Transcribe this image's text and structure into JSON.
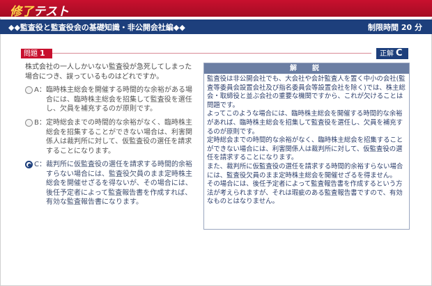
{
  "app": {
    "title_accent": "修了",
    "title_main": "テスト"
  },
  "subbar": {
    "subject": "◆◆監査役と監査役会の基礎知識・非公開会社編◆◆",
    "time_label": "制限時間 20 分"
  },
  "question": {
    "label": "問題",
    "number": "1",
    "text": "株式会社の一人しかいない監査役が急死してしまった場合につき、誤っているものはどれですか。"
  },
  "answer": {
    "label": "正解",
    "value": "C"
  },
  "options": [
    {
      "letter": "A：",
      "text": "臨時株主総会を開催する時間的な余裕がある場合には、臨時株主総会を招集して監査役を選任し、欠員を補充するのが原則です。",
      "selected": false
    },
    {
      "letter": "B：",
      "text": "定時総会までの時間的な余裕がなく、臨時株主総会を招集することができない場合は、利害関係人は裁判所に対して、仮監査役の選任を請求することになります。",
      "selected": false
    },
    {
      "letter": "C：",
      "text": "裁判所に仮監査役の選任を請求する時間的余裕すらない場合には、監査役欠員のまま定時株主総会を開催せざるを得ないが、その場合には、後任予定者によって監査報告書を作成すれば、有効な監査報告書になります。",
      "selected": true
    }
  ],
  "explanation": {
    "heading": "解　説",
    "paragraphs": [
      "監査役は非公開会社でも、大会社や会計監査人を置く中小の会社(監査等委員会設置会社及び指名委員会等設置会社を除く)では、株主総会・取締役と並ぶ会社の重要な機関ですから、これが欠けることは問題です。",
      "よってこのような場合には、臨時株主総会を開催する時間的な余裕があれば、臨時株主総会を招集して監査役を選任し、欠員を補充するのが原則です。",
      "定時総会までの時間的な余裕がなく、臨時株主総会を招集することができない場合には、利害関係人は裁判所に対して、仮監査役の選任を請求することになります。",
      "また、裁判所に仮監査役の選任を請求する時間的余裕すらない場合には、監査役欠員のまま定時株主総会を開催せざるを得ません。",
      "その場合には、後任予定者によって監査報告書を作成するという方法が考えられますが、それは瑕疵のある監査報告書ですので、有効なものとはなりません。"
    ]
  },
  "colors": {
    "header_red": "#c8102e",
    "subbar_navy": "#1d3f7c",
    "accent_yellow": "#ffd84a"
  }
}
